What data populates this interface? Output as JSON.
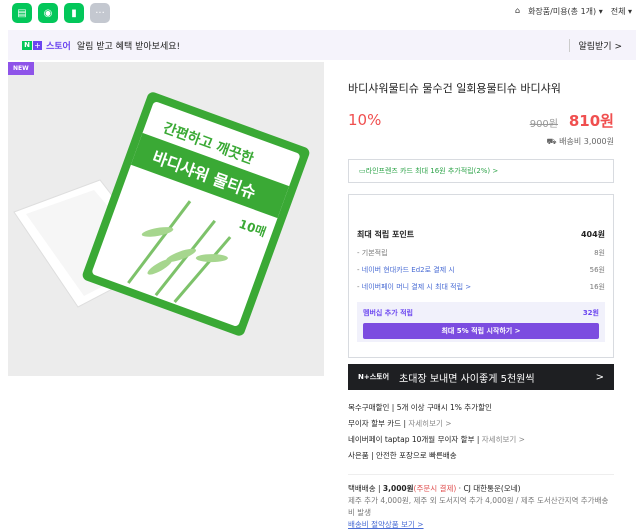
{
  "topbar": {
    "crumbs": [
      "화장품/미용(총 1개) ▾",
      "전체 ▾"
    ]
  },
  "banner": {
    "n": "N",
    "plus": "+",
    "store": "스토어",
    "text": "알림 받고 혜택 받아보세요!",
    "alarm": "알림받기 >"
  },
  "image": {
    "badge": "NEW",
    "pack_line1": "간편하고 깨끗한",
    "pack_line2": "바디샤워 물티슈",
    "pack_count": "10매"
  },
  "product": {
    "title": "바디샤워물티슈 물수건 일회용물티슈 바디샤워",
    "discount": "10%",
    "original_price": "900원",
    "sale_price": "810원",
    "shipping": "배송비 3,000원"
  },
  "card_benefit": "라인프렌즈 카드 최대 16원 추가적립(2%) >",
  "points": {
    "label": "최대 적립 포인트",
    "total": "404원",
    "rows": [
      {
        "label": "기본적립",
        "value": "8원"
      },
      {
        "label": "네이버 현대카드 Ed2로 결제 시",
        "value": "56원"
      },
      {
        "label": "네이버페이 머니 결제 시 최대 적립 >",
        "value": "16원"
      }
    ],
    "membership_label": "멤버십 추가 적립",
    "membership_value": "32원",
    "membership_btn": "최대 5% 적립 시작하기 >"
  },
  "invite": {
    "label": "N+스토어",
    "text": "초대장 보내면 사이좋게 5천원씩",
    "arrow": ">"
  },
  "perks": [
    {
      "label": "복수구매할인",
      "text": "5개 이상 구매시 1% 추가할인"
    },
    {
      "label": "무이자 할부 카드",
      "text": "자세히보기 >"
    },
    {
      "label": "네이버페이 taptap 10개월 무이자 할부",
      "text": "자세히보기 >"
    },
    {
      "label": "사은품",
      "text": "안전한 포장으로 빠른배송"
    }
  ],
  "delivery": {
    "label": "택배배송",
    "price": "3,000원",
    "cond": "(주문시 결제)",
    "carrier": "· CJ 대한통운(오네)",
    "extra": "제주 추가 4,000원, 제주 외 도서지역 추가 4,000원 / 제주 도서산간지역 추가배송비 발생",
    "link": "배송비 절약상품 보기 >"
  }
}
